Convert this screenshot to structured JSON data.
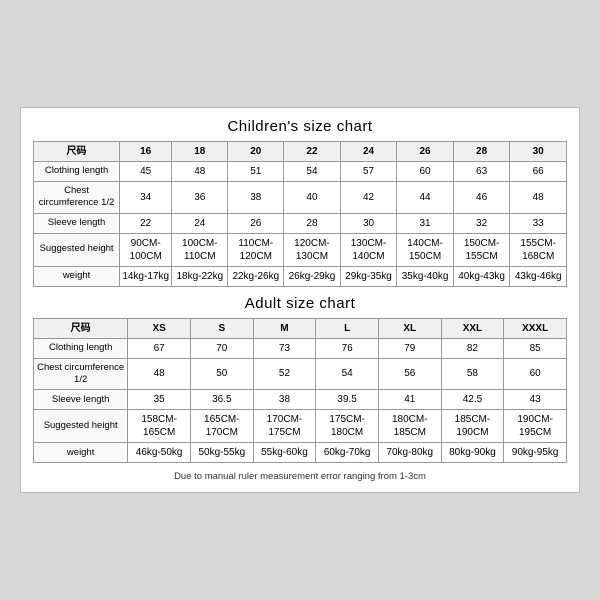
{
  "children_chart": {
    "title": "Children's size chart",
    "columns": [
      "尺码",
      "16",
      "18",
      "20",
      "22",
      "24",
      "26",
      "28",
      "30"
    ],
    "rows": [
      {
        "label": "Clothing length",
        "values": [
          "45",
          "48",
          "51",
          "54",
          "57",
          "60",
          "63",
          "66"
        ]
      },
      {
        "label": "Chest circumference 1/2",
        "values": [
          "34",
          "36",
          "38",
          "40",
          "42",
          "44",
          "46",
          "48"
        ]
      },
      {
        "label": "Sleeve length",
        "values": [
          "22",
          "24",
          "26",
          "28",
          "30",
          "31",
          "32",
          "33"
        ]
      },
      {
        "label": "Suggested height",
        "values": [
          "90CM-100CM",
          "100CM-110CM",
          "110CM-120CM",
          "120CM-130CM",
          "130CM-140CM",
          "140CM-150CM",
          "150CM-155CM",
          "155CM-168CM"
        ]
      },
      {
        "label": "weight",
        "values": [
          "14kg-17kg",
          "18kg-22kg",
          "22kg-26kg",
          "26kg-29kg",
          "29kg-35kg",
          "35kg-40kg",
          "40kg-43kg",
          "43kg-46kg"
        ]
      }
    ]
  },
  "adult_chart": {
    "title": "Adult size chart",
    "columns": [
      "尺码",
      "XS",
      "S",
      "M",
      "L",
      "XL",
      "XXL",
      "XXXL"
    ],
    "rows": [
      {
        "label": "Clothing length",
        "values": [
          "67",
          "70",
          "73",
          "76",
          "79",
          "82",
          "85"
        ]
      },
      {
        "label": "Chest circumference 1/2",
        "values": [
          "48",
          "50",
          "52",
          "54",
          "56",
          "58",
          "60"
        ]
      },
      {
        "label": "Sleeve length",
        "values": [
          "35",
          "36.5",
          "38",
          "39.5",
          "41",
          "42.5",
          "43"
        ]
      },
      {
        "label": "Suggested height",
        "values": [
          "158CM-165CM",
          "165CM-170CM",
          "170CM-175CM",
          "175CM-180CM",
          "180CM-185CM",
          "185CM-190CM",
          "190CM-195CM"
        ]
      },
      {
        "label": "weight",
        "values": [
          "46kg-50kg",
          "50kg-55kg",
          "55kg-60kg",
          "60kg-70kg",
          "70kg-80kg",
          "80kg-90kg",
          "90kg-95kg"
        ]
      }
    ]
  },
  "note": "Due to manual ruler measurement error ranging from 1-3cm"
}
